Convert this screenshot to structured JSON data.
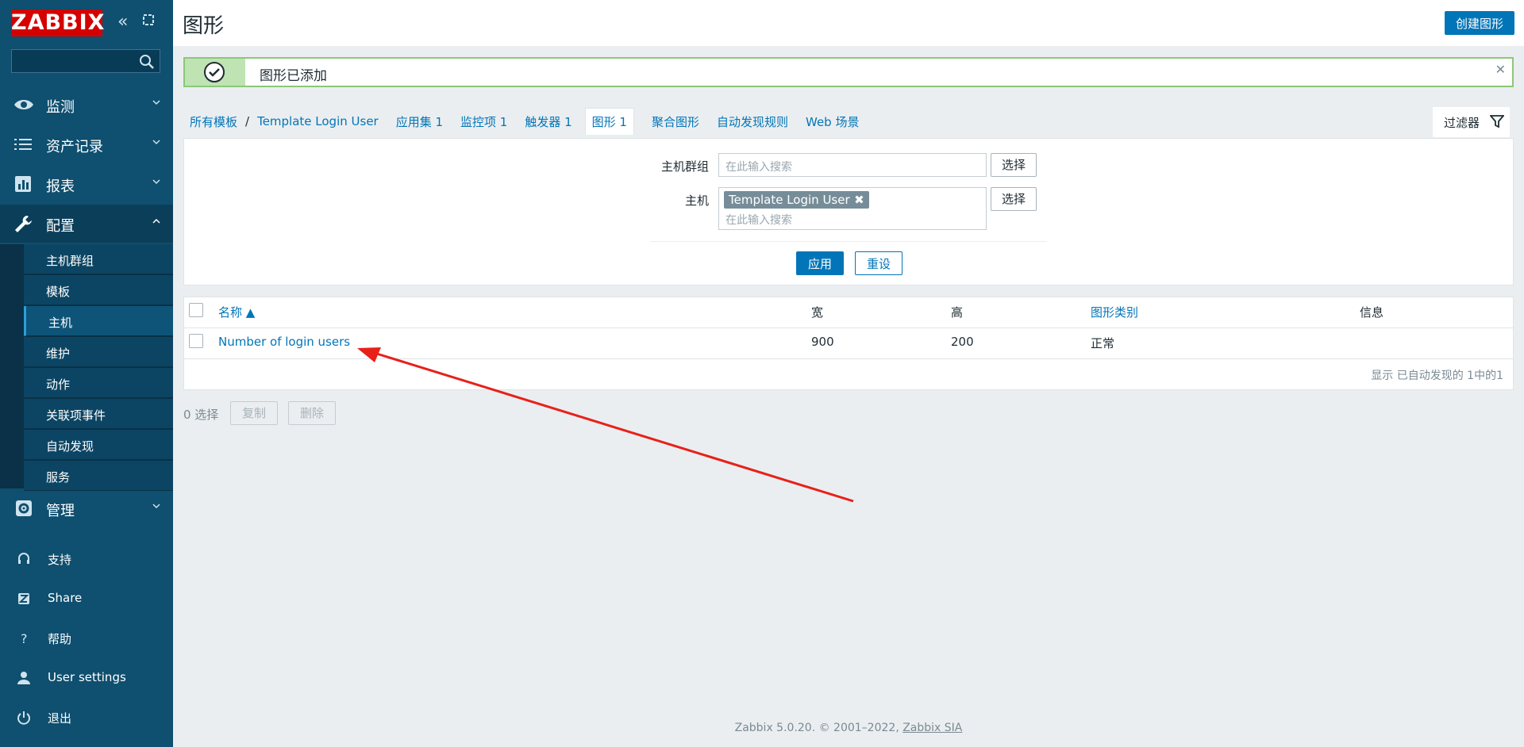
{
  "sidebar": {
    "logo": "ZABBIX",
    "search_placeholder": "",
    "menu": [
      {
        "label": "监测",
        "icon": "eye-icon"
      },
      {
        "label": "资产记录",
        "icon": "list-icon"
      },
      {
        "label": "报表",
        "icon": "bar-chart-icon"
      },
      {
        "label": "配置",
        "icon": "wrench-icon"
      },
      {
        "label": "管理",
        "icon": "gear-icon"
      }
    ],
    "config_submenu": [
      "主机群组",
      "模板",
      "主机",
      "维护",
      "动作",
      "关联项事件",
      "自动发现",
      "服务"
    ],
    "active_submenu": "主机",
    "bottom": [
      {
        "label": "支持",
        "icon": "headset-icon"
      },
      {
        "label": "Share",
        "icon": "share-icon"
      },
      {
        "label": "帮助",
        "icon": "help-icon"
      },
      {
        "label": "User settings",
        "icon": "user-icon"
      },
      {
        "label": "退出",
        "icon": "power-icon"
      }
    ]
  },
  "header": {
    "title": "图形",
    "create_button": "创建图形"
  },
  "message": {
    "text": "图形已添加",
    "type": "success"
  },
  "breadcrumb": {
    "all_templates": "所有模板",
    "separator": "/",
    "template": "Template Login User",
    "tabs": [
      "应用集 1",
      "监控项 1",
      "触发器 1",
      "图形 1",
      "聚合图形",
      "自动发现规则",
      "Web 场景"
    ],
    "selected_tab": "图形 1"
  },
  "filter": {
    "tab_label": "过滤器",
    "host_group_label": "主机群组",
    "host_label": "主机",
    "search_placeholder": "在此输入搜索",
    "select_button": "选择",
    "host_chip": "Template Login User",
    "apply_button": "应用",
    "reset_button": "重设"
  },
  "table": {
    "columns": [
      "名称 ▲",
      "宽",
      "高",
      "图形类别",
      "信息"
    ],
    "rows": [
      {
        "name": "Number of login users",
        "width": "900",
        "height": "200",
        "type": "正常",
        "info": ""
      }
    ],
    "summary": "显示 已自动发现的 1中的1"
  },
  "actions": {
    "selected_count": "0 选择",
    "copy_button": "复制",
    "delete_button": "删除"
  },
  "footer": {
    "text": "Zabbix 5.0.20. © 2001–2022,",
    "link": "Zabbix SIA"
  },
  "colors": {
    "sidebar_bg": "#0f4f6f",
    "accent": "#0275b8",
    "logo_red": "#d40000",
    "success_green": "#8bc877",
    "annotation_arrow": "#e8201a"
  }
}
